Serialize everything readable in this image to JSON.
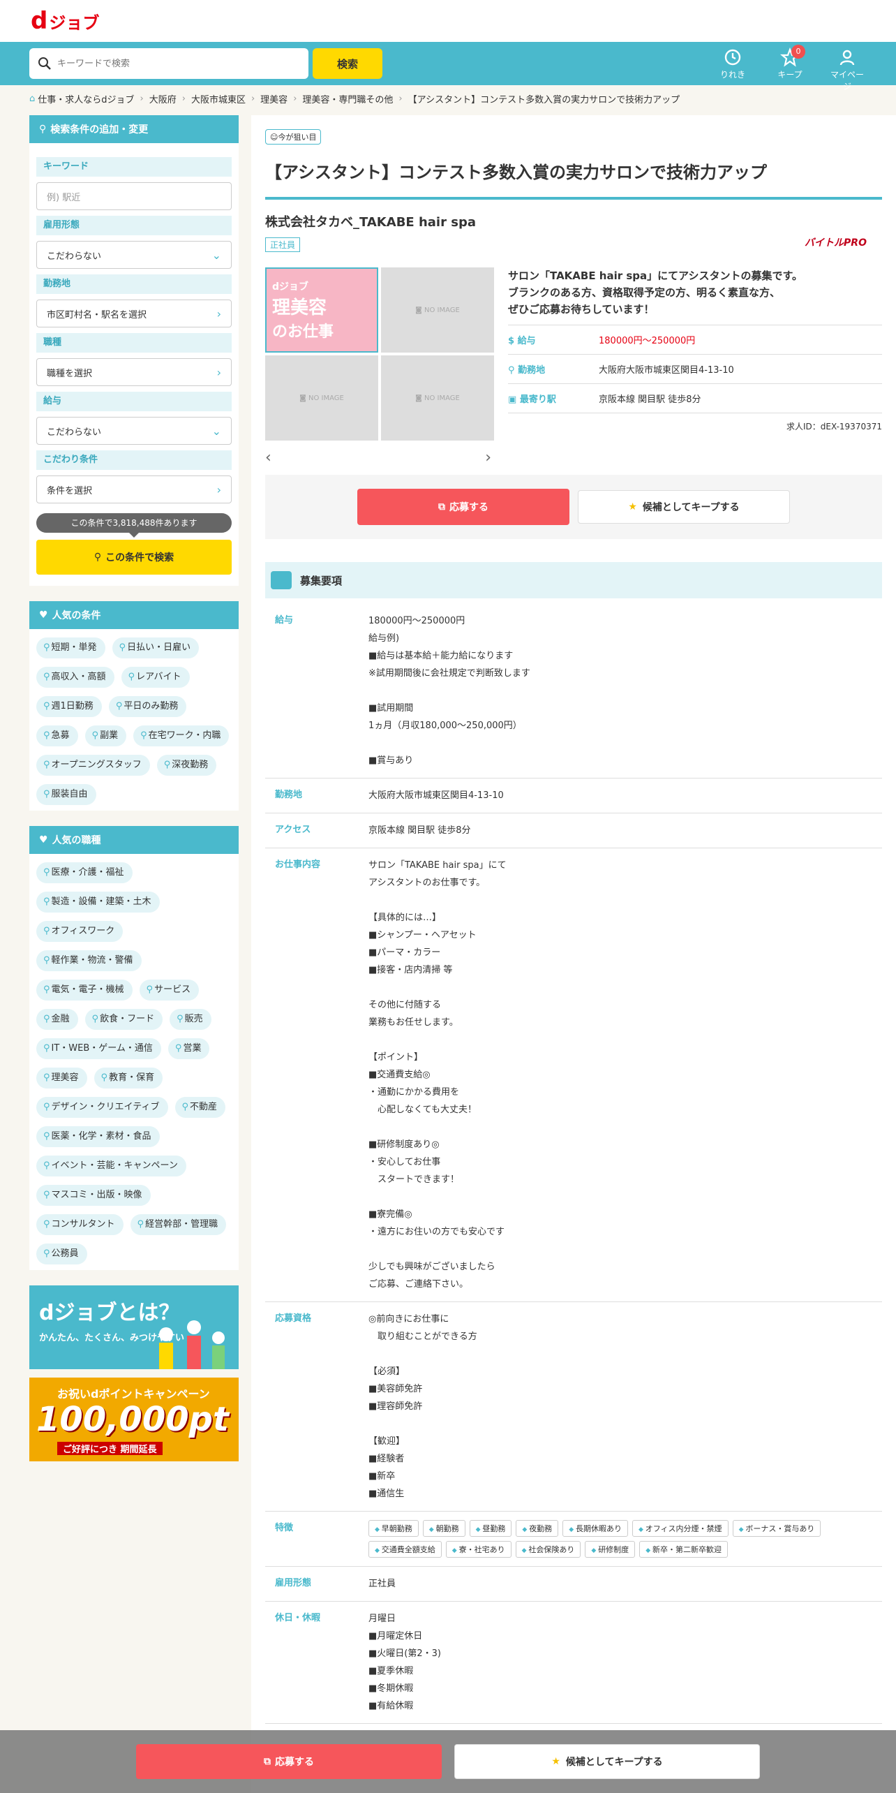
{
  "brand": {
    "logo_d": "d",
    "logo_text": "ジョブ"
  },
  "search": {
    "placeholder": "キーワードで検索",
    "button": "検索"
  },
  "header_icons": {
    "history": "りれき",
    "keep": "キープ",
    "keep_count": "0",
    "mypage": "マイページ"
  },
  "breadcrumb": [
    "仕事・求人ならdジョブ",
    "大阪府",
    "大阪市城東区",
    "理美容",
    "理美容・専門職その他",
    "【アシスタント】コンテスト多数入賞の実力サロンで技術力アップ"
  ],
  "sidebar": {
    "search_head": "検索条件の追加・変更",
    "keyword_label": "キーワード",
    "keyword_placeholder": "例) 駅近",
    "employment_label": "雇用形態",
    "employment_value": "こだわらない",
    "location_label": "勤務地",
    "location_value": "市区町村名・駅名を選択",
    "job_label": "職種",
    "job_value": "職種を選択",
    "salary_label": "給与",
    "salary_value": "こだわらない",
    "conditions_label": "こだわり条件",
    "conditions_value": "条件を選択",
    "count_text": "この条件で3,818,488件あります",
    "search_button": "この条件で検索",
    "popular_conditions_head": "人気の条件",
    "popular_conditions": [
      "短期・単発",
      "日払い・日雇い",
      "高収入・高額",
      "レアバイト",
      "週1日勤務",
      "平日のみ勤務",
      "急募",
      "副業",
      "在宅ワーク・内職",
      "オープニングスタッフ",
      "深夜勤務",
      "服装自由"
    ],
    "popular_jobs_head": "人気の職種",
    "popular_jobs": [
      "医療・介護・福祉",
      "製造・設備・建築・土木",
      "オフィスワーク",
      "軽作業・物流・警備",
      "電気・電子・機械",
      "サービス",
      "金融",
      "飲食・フード",
      "販売",
      "IT・WEB・ゲーム・通信",
      "営業",
      "理美容",
      "教育・保育",
      "デザイン・クリエイティブ",
      "不動産",
      "医薬・化学・素材・食品",
      "イベント・芸能・キャンペーン",
      "マスコミ・出版・映像",
      "コンサルタント",
      "経営幹部・管理職",
      "公務員"
    ],
    "banner1_title": "dジョブとは？",
    "banner1_sub": "かんたん、たくさん、みつけやすい",
    "banner2_top": "お祝いdポイントキャンペーン",
    "banner2_main": "100,000pt",
    "banner2_bottom": "ご好評につき 期間延長"
  },
  "job": {
    "catch": "今が狙い目",
    "title": "【アシスタント】コンテスト多数入賞の実力サロンで技術力アップ",
    "company": "株式会社タカベ_TAKABE hair spa",
    "employment": "正社員",
    "source": "バイトルPRO",
    "photo_main_lines": [
      "dジョブ",
      "理美容",
      "のお仕事"
    ],
    "no_image": "NO IMAGE",
    "lead": "サロン「TAKABE hair spa」にてアシスタントの募集です。\nブランクのある方、資格取得予定の方、明るく素直な方、\nぜひご応募お待ちしています！",
    "salary_label": "給与",
    "salary": "180000円〜250000円",
    "location_label": "勤務地",
    "location": "大阪府大阪市城東区関目4-13-10",
    "station_label": "最寄り駅",
    "station": "京阪本線 関目駅 徒歩8分",
    "job_id": "求人ID：dEX-19370371",
    "apply": "応募する",
    "keep": "候補としてキープする",
    "req_head": "募集要項",
    "rows": [
      {
        "k": "給与",
        "v": "180000円〜250000円\n給与例)\n■給与は基本給＋能力給になります\n※試用期間後に会社規定で判断致します\n\n■試用期間\n1ヵ月（月収180,000～250,000円）\n\n■賞与あり"
      },
      {
        "k": "勤務地",
        "v": "大阪府大阪市城東区関目4-13-10"
      },
      {
        "k": "アクセス",
        "v": "京阪本線 関目駅 徒歩8分"
      },
      {
        "k": "お仕事内容",
        "v": "サロン「TAKABE hair spa」にて\nアシスタントのお仕事です。\n\n【具体的には…】\n■シャンプー・ヘアセット\n■パーマ・カラー\n■接客・店内清掃 等\n\nその他に付随する\n業務もお任せします。\n\n【ポイント】\n■交通費支給◎\n・通勤にかかる費用を\n　心配しなくても大丈夫！\n\n■研修制度あり◎\n・安心してお仕事\n　スタートできます！\n\n■寮完備◎\n・遠方にお住いの方でも安心です\n\n少しでも興味がございましたら\nご応募、ご連絡下さい。"
      },
      {
        "k": "応募資格",
        "v": "◎前向きにお仕事に\n　取り組むことができる方\n\n【必須】\n■美容師免許\n■理容師免許\n\n【歓迎】\n■経験者\n■新卒\n■通信生"
      },
      {
        "k": "特徴",
        "v": ""
      },
      {
        "k": "雇用形態",
        "v": "正社員"
      },
      {
        "k": "休日・休暇",
        "v": "月曜日\n■月曜定休日\n■火曜日(第2・3)\n■夏季休暇\n■冬期休暇\n■有給休暇"
      }
    ],
    "features": [
      "早朝勤務",
      "朝勤務",
      "昼勤務",
      "夜勤務",
      "長期休暇あり",
      "オフィス内分煙・禁煙",
      "ボーナス・賞与あり",
      "交通費全額支給",
      "寮・社宅あり",
      "社会保険あり",
      "研修制度",
      "新卒・第二新卒歓迎"
    ]
  },
  "colors": {
    "accent": "#4ab9cc",
    "apply": "#f6565b",
    "search": "#ffd900",
    "brand": "#e60012"
  }
}
